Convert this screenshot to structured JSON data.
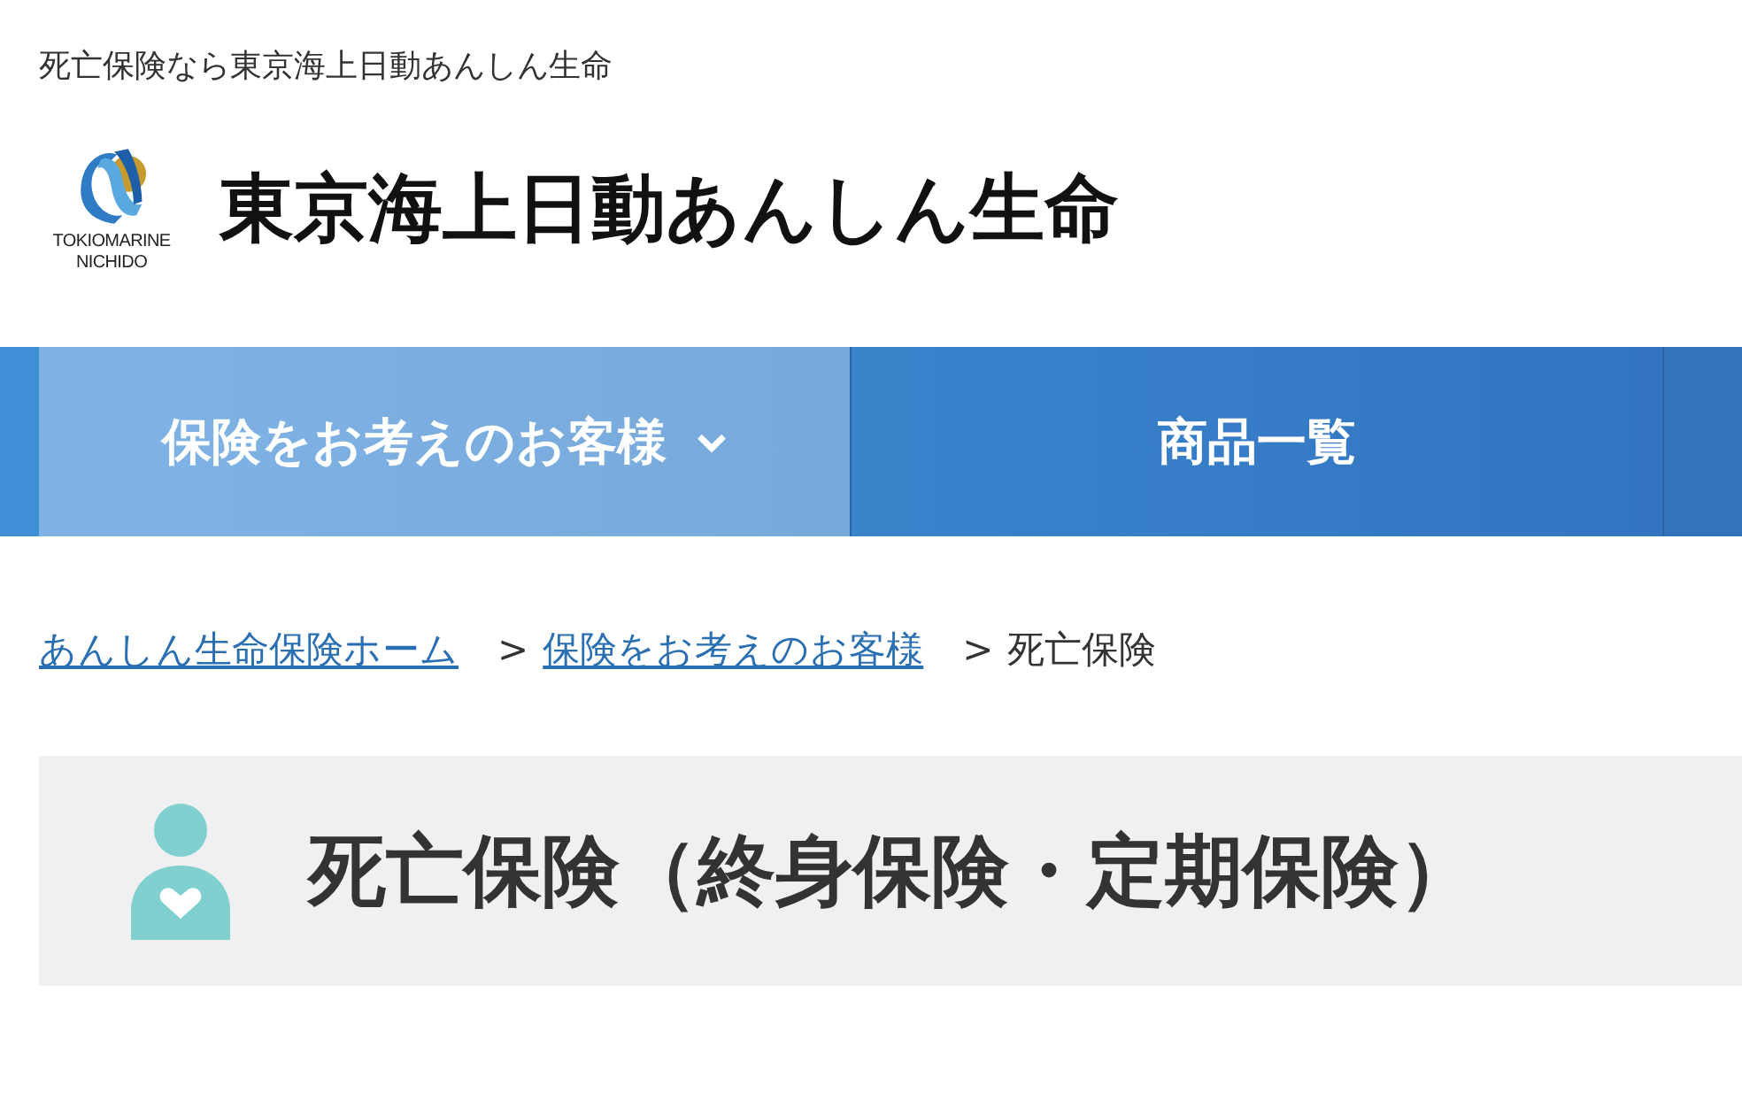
{
  "tagline": "死亡保険なら東京海上日動あんしん生命",
  "logo": {
    "brand_line_1": "TOKIOMARINE",
    "brand_line_2": "NICHIDO"
  },
  "site_title": "東京海上日動あんしん生命",
  "nav": [
    {
      "label": "保険をお考えのお客様",
      "selected": true,
      "dropdown": true
    },
    {
      "label": "商品一覧",
      "selected": false,
      "dropdown": false
    }
  ],
  "breadcrumb": [
    {
      "label": "あんしん生命保険ホーム",
      "link": true
    },
    {
      "label": "保険をお考えのお客様",
      "link": true
    },
    {
      "label": "死亡保険",
      "link": false
    }
  ],
  "breadcrumb_separator": ">",
  "page_title": "死亡保険（終身保険・定期保険）"
}
